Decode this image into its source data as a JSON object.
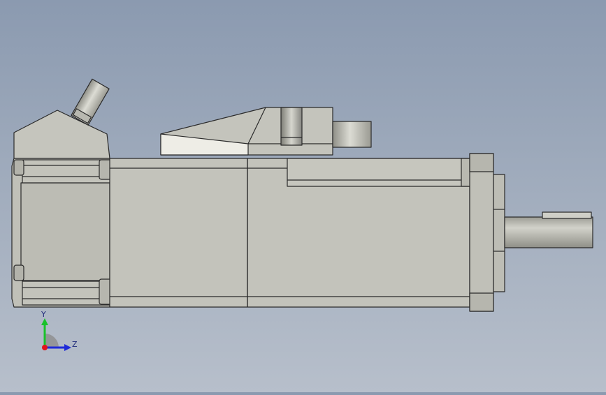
{
  "viewport": {
    "model": "servo-motor-side-view",
    "view": "right",
    "colors": {
      "background_top": "#8b9ab0",
      "background_bottom": "#b7bfcb",
      "body": "#c3c3bb",
      "body_shadow": "#a9a9a1",
      "edge": "#2a2a2a",
      "highlight": "#ecebe4"
    }
  },
  "triad": {
    "y_label": "Y",
    "z_label": "Z",
    "colors": {
      "y": "#19c22a",
      "z": "#1f2bd8",
      "x": "#e0141c"
    }
  }
}
